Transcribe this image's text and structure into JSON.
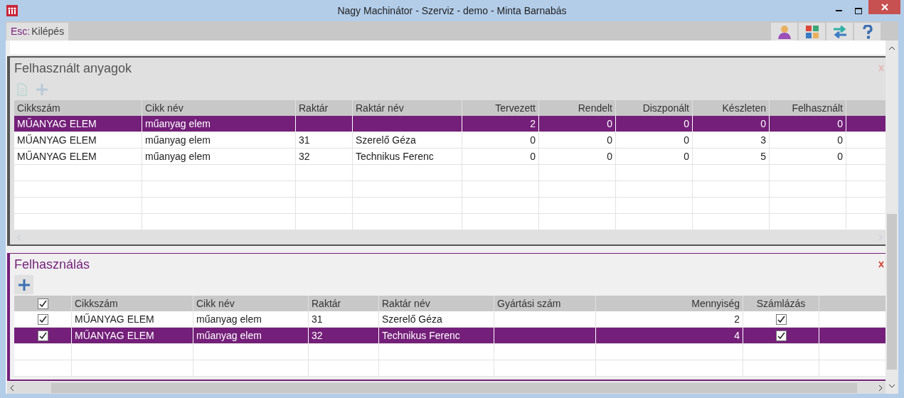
{
  "window": {
    "title": "Nagy Machinátor - Szerviz - demo - Minta Barnabás"
  },
  "toolbar": {
    "key": "Esc:",
    "label": "Kilépés"
  },
  "materials": {
    "title": "Felhasznált anyagok",
    "columns": [
      {
        "label": "Cikkszám",
        "kind": "text"
      },
      {
        "label": "Cikk név",
        "kind": "text"
      },
      {
        "label": "Raktár",
        "kind": "text"
      },
      {
        "label": "Raktár név",
        "kind": "text"
      },
      {
        "label": "Tervezett",
        "kind": "number"
      },
      {
        "label": "Rendelt",
        "kind": "number"
      },
      {
        "label": "Diszponált",
        "kind": "number"
      },
      {
        "label": "Készleten",
        "kind": "number"
      },
      {
        "label": "Felhasznált",
        "kind": "number"
      }
    ],
    "rows": [
      {
        "selected": true,
        "cells": [
          "MŰANYAG ELEM",
          "műanyag elem",
          "",
          "",
          "2",
          "0",
          "0",
          "0",
          "0"
        ]
      },
      {
        "selected": false,
        "cells": [
          "MŰANYAG ELEM",
          "műanyag elem",
          "31",
          "Szerelő Géza",
          "0",
          "0",
          "0",
          "3",
          "0"
        ]
      },
      {
        "selected": false,
        "cells": [
          "MŰANYAG ELEM",
          "műanyag elem",
          "32",
          "Technikus Ferenc",
          "0",
          "0",
          "0",
          "5",
          "0"
        ]
      }
    ]
  },
  "usage": {
    "title": "Felhasználás",
    "header_checked": true,
    "columns": [
      {
        "label": "Cikkszám",
        "kind": "text"
      },
      {
        "label": "Cikk név",
        "kind": "text"
      },
      {
        "label": "Raktár",
        "kind": "text"
      },
      {
        "label": "Raktár név",
        "kind": "text"
      },
      {
        "label": "Gyártási szám",
        "kind": "text"
      },
      {
        "label": "Mennyiség",
        "kind": "number"
      },
      {
        "label": "Számlázás",
        "kind": "check"
      }
    ],
    "rows": [
      {
        "selected": false,
        "checked": true,
        "cells": [
          "MŰANYAG ELEM",
          "műanyag elem",
          "31",
          "Szerelő Géza",
          "",
          "2"
        ],
        "billed": true
      },
      {
        "selected": true,
        "checked": true,
        "cells": [
          "MŰANYAG ELEM",
          "műanyag elem",
          "32",
          "Technikus Ferenc",
          "",
          "4"
        ],
        "billed": true
      }
    ]
  }
}
